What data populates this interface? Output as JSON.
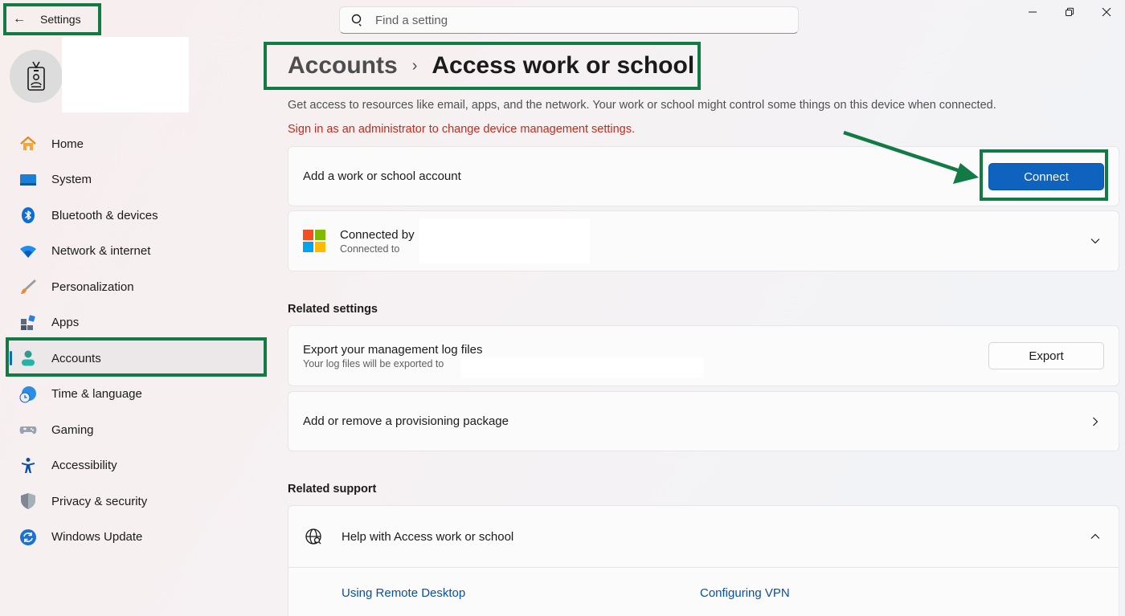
{
  "titlebar": {
    "app_title": "Settings",
    "search_placeholder": "Find a setting"
  },
  "sidebar": {
    "items": [
      {
        "label": "Home",
        "icon": "home-icon"
      },
      {
        "label": "System",
        "icon": "system-icon"
      },
      {
        "label": "Bluetooth & devices",
        "icon": "bluetooth-icon"
      },
      {
        "label": "Network & internet",
        "icon": "wifi-icon"
      },
      {
        "label": "Personalization",
        "icon": "brush-icon"
      },
      {
        "label": "Apps",
        "icon": "apps-icon"
      },
      {
        "label": "Accounts",
        "icon": "person-icon",
        "active": true
      },
      {
        "label": "Time & language",
        "icon": "globe-clock-icon"
      },
      {
        "label": "Gaming",
        "icon": "controller-icon"
      },
      {
        "label": "Accessibility",
        "icon": "accessibility-icon"
      },
      {
        "label": "Privacy & security",
        "icon": "shield-icon"
      },
      {
        "label": "Windows Update",
        "icon": "update-icon"
      }
    ]
  },
  "breadcrumb": {
    "parent": "Accounts",
    "separator": "›",
    "current": "Access work or school"
  },
  "description": "Get access to resources like email, apps, and the network. Your work or school might control some things on this device when connected.",
  "admin_warning": "Sign in as an administrator to change device management settings.",
  "add_account": {
    "label": "Add a work or school account",
    "button": "Connect"
  },
  "connected_account": {
    "title": "Connected by",
    "subtitle": "Connected to"
  },
  "related_settings": {
    "heading": "Related settings",
    "export": {
      "title": "Export your management log files",
      "subtitle": "Your log files will be exported to",
      "button": "Export"
    },
    "provisioning": {
      "title": "Add or remove a provisioning package"
    }
  },
  "related_support": {
    "heading": "Related support",
    "help_title": "Help with Access work or school",
    "links": [
      "Using Remote Desktop",
      "Configuring VPN"
    ]
  },
  "colors": {
    "accent": "#0f62be",
    "annotation": "#127a44",
    "warning": "#c42b1c",
    "link": "#0b4fa2"
  }
}
